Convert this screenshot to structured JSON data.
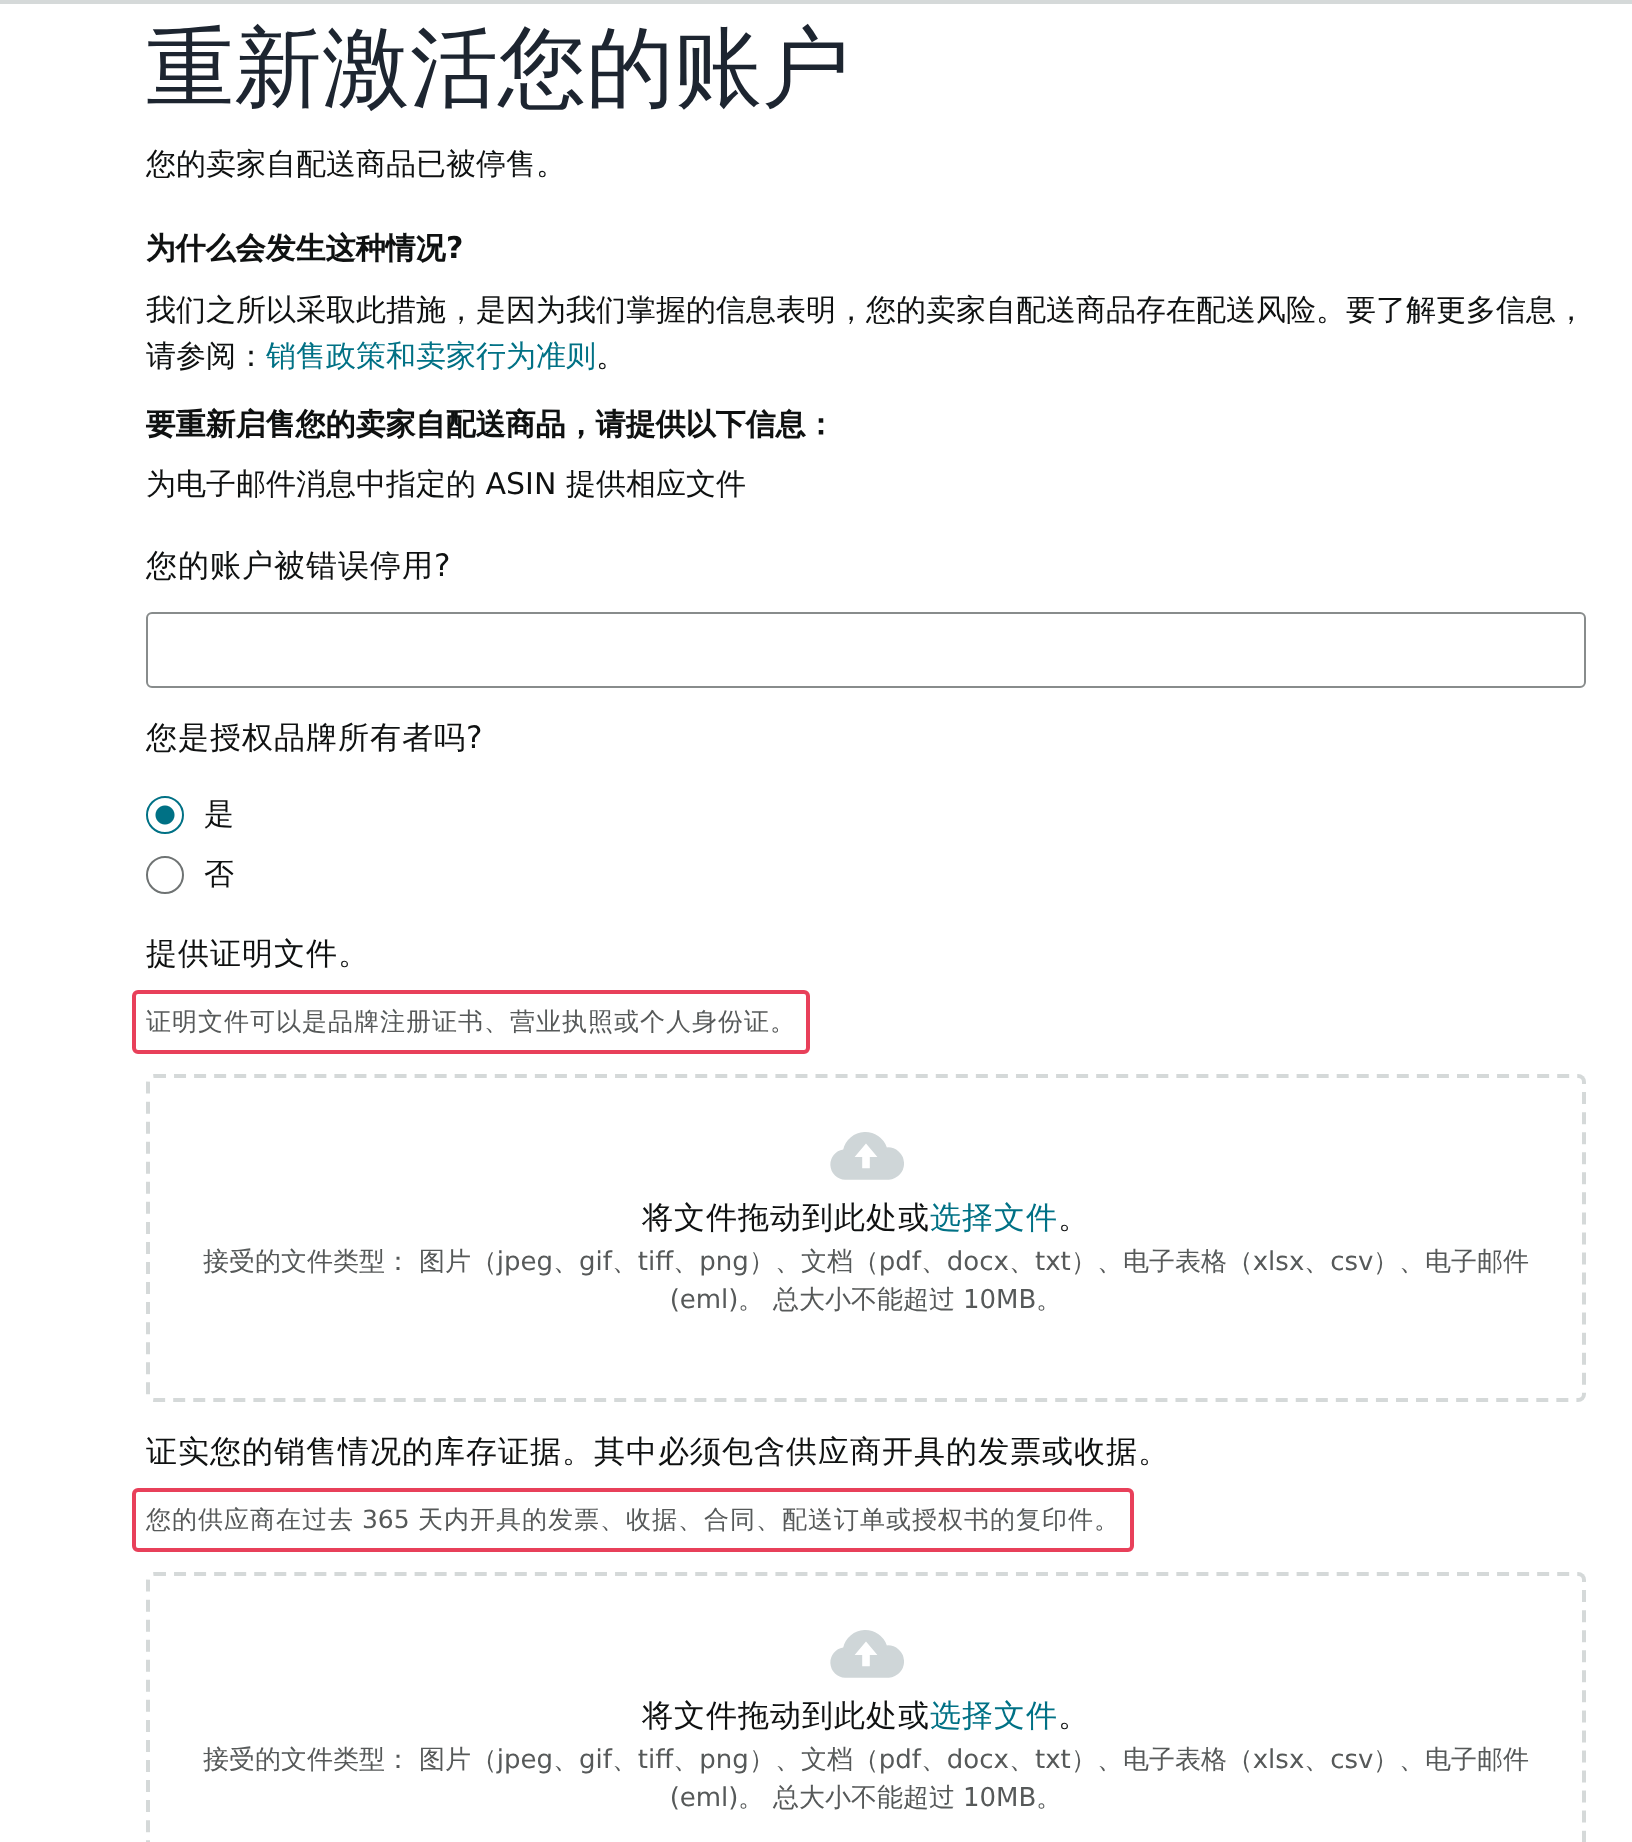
{
  "title": "重新激活您的账户",
  "subtitle": "您的卖家自配送商品已被停售。",
  "why": {
    "heading": "为什么会发生这种情况?",
    "text": "我们之所以采取此措施，是因为我们掌握的信息表明，您的卖家自配送商品存在配送风险。要了解更多信息，请参阅：",
    "link": "销售政策和卖家行为准则",
    "suffix": "。"
  },
  "requirement": {
    "heading": "要重新启售您的卖家自配送商品，请提供以下信息：",
    "note": "为电子邮件消息中指定的 ASIN 提供相应文件"
  },
  "fields": [
    {
      "kind": "text",
      "label": "您的账户被错误停用?"
    },
    {
      "kind": "radio",
      "label": "您是授权品牌所有者吗?",
      "options": [
        {
          "label": "是",
          "selected": true
        },
        {
          "label": "否",
          "selected": false
        }
      ]
    },
    {
      "kind": "upload",
      "label": "提供证明文件。",
      "hint": "证明文件可以是品牌注册证书、营业执照或个人身份证。",
      "highlighted": true,
      "prompt": "将文件拖动到此处或",
      "link": "选择文件",
      "suffix": "。",
      "types": "接受的文件类型： 图片（jpeg、gif、tiff、png）、文档（pdf、docx、txt）、电子表格（xlsx、csv）、电子邮件 (eml)。 总大小不能超过 10MB。"
    },
    {
      "kind": "upload",
      "label": "证实您的销售情况的库存证据。其中必须包含供应商开具的发票或收据。",
      "hint": "您的供应商在过去 365 天内开具的发票、收据、合同、配送订单或授权书的复印件。",
      "highlighted": true,
      "prompt": "将文件拖动到此处或",
      "link": "选择文件",
      "suffix": "。",
      "types": "接受的文件类型： 图片（jpeg、gif、tiff、png）、文档（pdf、docx、txt）、电子表格（xlsx、csv）、电子邮件 (eml)。 总大小不能超过 10MB。"
    }
  ]
}
